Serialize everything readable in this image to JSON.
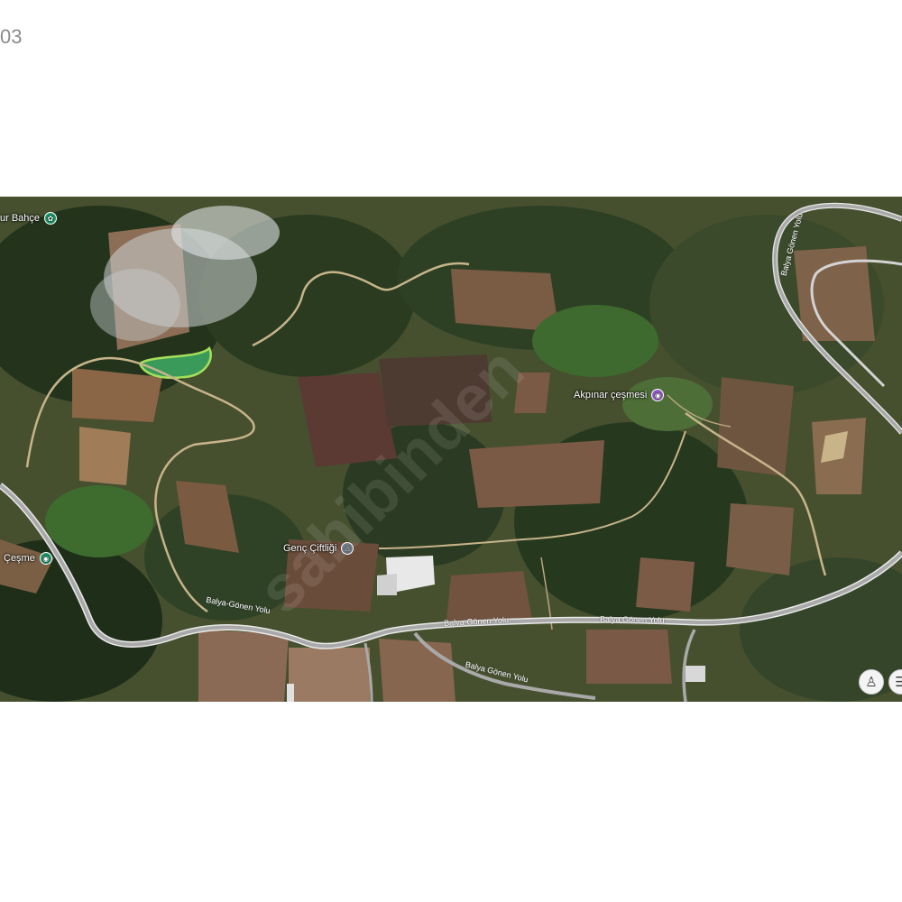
{
  "corner_label": "03",
  "watermark": "sahibinden",
  "pois": [
    {
      "name": "poi-bahce",
      "label": "ur Bahçe",
      "icon": "park-icon",
      "color": "#1f9e6e"
    },
    {
      "name": "poi-cesme-west",
      "label": "Çeşme",
      "icon": "fountain-icon",
      "color": "#1f9e6e"
    },
    {
      "name": "poi-genc-ciftligi",
      "label": "Genç Çiftliği",
      "icon": "farm-icon",
      "color": "#6f7a86"
    },
    {
      "name": "poi-akpinar-cesmesi",
      "label": "Akpınar çeşmesi",
      "icon": "fountain-icon",
      "color": "#9b5fd1"
    }
  ],
  "roads": [
    {
      "label": "Balya-Gönen Yolu"
    },
    {
      "label": "Balya-Gönen Yolu"
    },
    {
      "label": "Balya Gönen Yolu"
    },
    {
      "label": "Balya Gönen Yolu"
    },
    {
      "label": "Balya Gönen Yolu"
    }
  ],
  "controls": {
    "pegman_icon": "pegman-icon",
    "layers_icon": "layers-icon"
  }
}
